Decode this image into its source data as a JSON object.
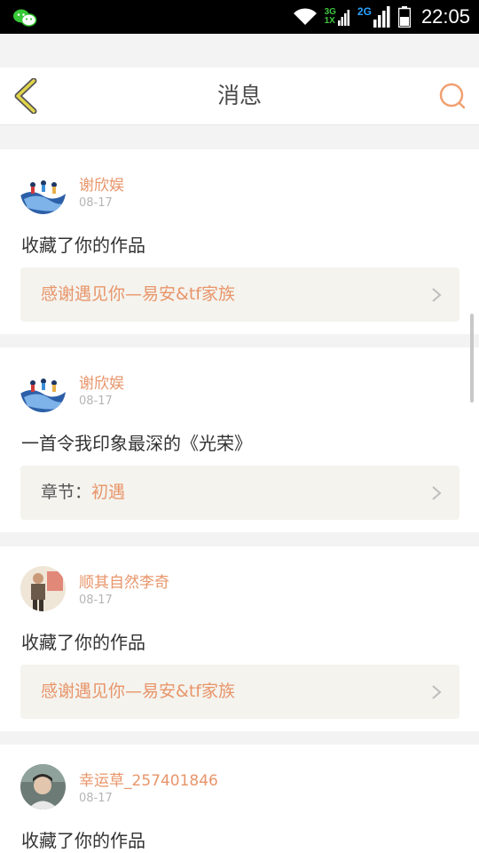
{
  "status_bar": {
    "time": "22:05",
    "network_primary": "3G",
    "network_primary_sub": "1X",
    "network_secondary": "2G",
    "icons": [
      "wechat-icon",
      "wifi-icon",
      "signal-icon",
      "battery-icon"
    ]
  },
  "header": {
    "title": "消息",
    "back_icon": "chevron-left-icon",
    "search_icon": "search-icon"
  },
  "colors": {
    "accent": "#e8956a",
    "back_yellow": "#e2d44a",
    "divider": "#f3f3f3"
  },
  "messages": [
    {
      "user": "谢欣娱",
      "date": "08-17",
      "action": "收藏了你的作品",
      "link_prefix": "",
      "link_text": "感谢遇见你—易安&tf家族"
    },
    {
      "user": "谢欣娱",
      "date": "08-17",
      "action": "一首令我印象最深的《光荣》",
      "link_prefix": "章节：",
      "link_text": "初遇"
    },
    {
      "user": "顺其自然李奇",
      "date": "08-17",
      "action": "收藏了你的作品",
      "link_prefix": "",
      "link_text": "感谢遇见你—易安&tf家族"
    },
    {
      "user": "幸运草_257401846",
      "date": "08-17",
      "action": "收藏了你的作品",
      "link_prefix": "",
      "link_text": ""
    }
  ]
}
